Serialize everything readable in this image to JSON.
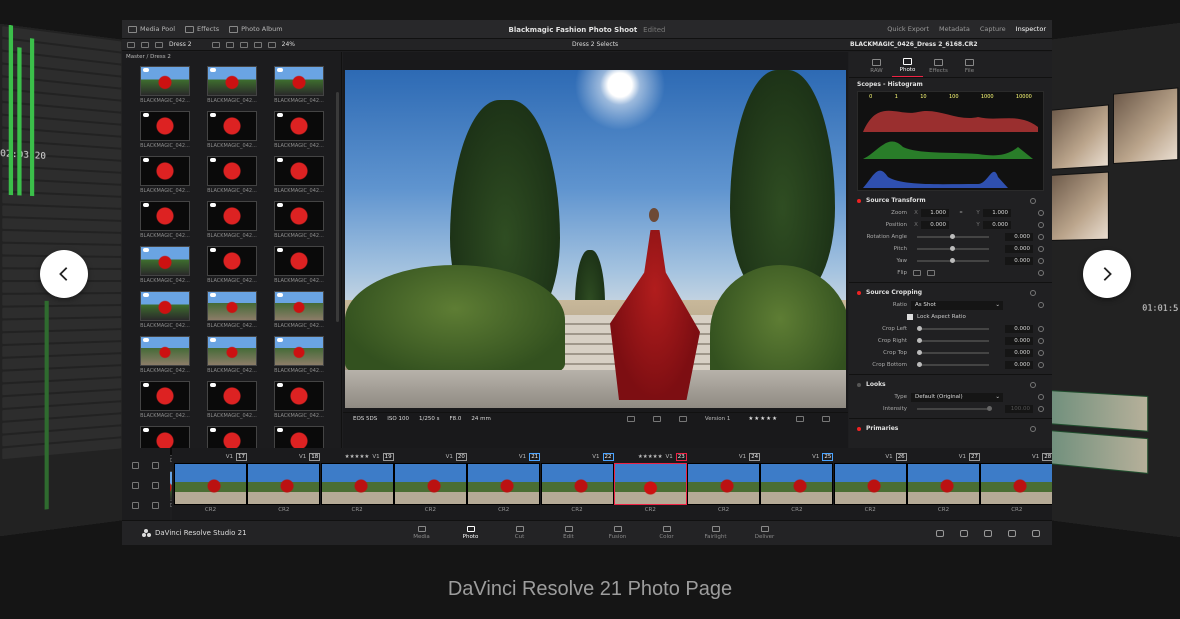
{
  "topbar": {
    "media_pool": "Media Pool",
    "effects": "Effects",
    "photo_album": "Photo Album",
    "title": "Blackmagic Fashion Photo Shoot",
    "edited": "Edited",
    "quick_export": "Quick Export",
    "metadata": "Metadata",
    "capture": "Capture",
    "inspector": "Inspector"
  },
  "toolbar": {
    "album": "Dress 2",
    "zoom": "24%",
    "viewer_selection": "Dress 2 Selects",
    "clip_name": "BLACKMAGIC_0426_Dress 2_6168.CR2"
  },
  "pool": {
    "path": "Master / Dress 2",
    "thumb_label": "BLACKMAGIC_042...",
    "thumbs": [
      "a",
      "a",
      "a",
      "b",
      "b",
      "b",
      "b",
      "b",
      "b",
      "b",
      "b",
      "b",
      "a",
      "b",
      "b",
      "a",
      "c",
      "c",
      "c",
      "c",
      "c",
      "b",
      "b",
      "b",
      "b",
      "b",
      "b",
      "a",
      "b",
      "b"
    ]
  },
  "viewer_info": {
    "camera": "EOS 5DS",
    "iso": "ISO 100",
    "shutter": "1/250 s",
    "aperture": "F8.0",
    "focal": "24 mm",
    "version": "Version 1",
    "stars": "★★★★★"
  },
  "inspector": {
    "tabs": [
      "RAW",
      "Photo",
      "Effects",
      "File"
    ],
    "scopes_title": "Scopes - Histogram",
    "histo_scale": [
      "0",
      "1",
      "10",
      "100",
      "1000",
      "10000"
    ],
    "source_transform": "Source Transform",
    "zoom_label": "Zoom",
    "zoom_x": "1.000",
    "zoom_y": "1.000",
    "position_label": "Position",
    "pos_x": "0.000",
    "pos_y": "0.000",
    "rotation_label": "Rotation Angle",
    "rotation": "0.000",
    "pitch_label": "Pitch",
    "pitch": "0.000",
    "yaw_label": "Yaw",
    "yaw": "0.000",
    "flip_label": "Flip",
    "axis_x": "X",
    "axis_y": "Y",
    "source_cropping": "Source Cropping",
    "ratio_label": "Ratio",
    "ratio": "As Shot",
    "lock_aspect": "Lock Aspect Ratio",
    "crop_left_label": "Crop Left",
    "crop_left": "0.000",
    "crop_right_label": "Crop Right",
    "crop_right": "0.000",
    "crop_top_label": "Crop Top",
    "crop_top": "0.000",
    "crop_bottom_label": "Crop Bottom",
    "crop_bottom": "0.000",
    "looks": "Looks",
    "type_label": "Type",
    "type": "Default (Original)",
    "intensity_label": "Intensity",
    "intensity": "100.00",
    "primaries": "Primaries"
  },
  "filmstrip": {
    "track": "V1",
    "format": "CR2",
    "frames": [
      {
        "num": "17",
        "color": "",
        "stars": ""
      },
      {
        "num": "18",
        "color": "",
        "stars": ""
      },
      {
        "num": "19",
        "color": "",
        "stars": "★★★★★"
      },
      {
        "num": "20",
        "color": "",
        "stars": ""
      },
      {
        "num": "21",
        "color": "blue",
        "stars": ""
      },
      {
        "num": "22",
        "color": "blue",
        "stars": ""
      },
      {
        "num": "23",
        "color": "red",
        "stars": "★★★★★"
      },
      {
        "num": "24",
        "color": "",
        "stars": ""
      },
      {
        "num": "25",
        "color": "blue",
        "stars": ""
      },
      {
        "num": "26",
        "color": "",
        "stars": ""
      },
      {
        "num": "27",
        "color": "",
        "stars": ""
      },
      {
        "num": "28",
        "color": "",
        "stars": ""
      }
    ]
  },
  "pagebar": {
    "brand": "DaVinci Resolve Studio 21",
    "pages": [
      "Media",
      "Photo",
      "Cut",
      "Edit",
      "Fusion",
      "Color",
      "Fairlight",
      "Deliver"
    ],
    "active": "Photo"
  },
  "side": {
    "left_time": "02:03:20",
    "right_time": "01:01:5"
  },
  "caption": "DaVinci Resolve 21 Photo Page"
}
